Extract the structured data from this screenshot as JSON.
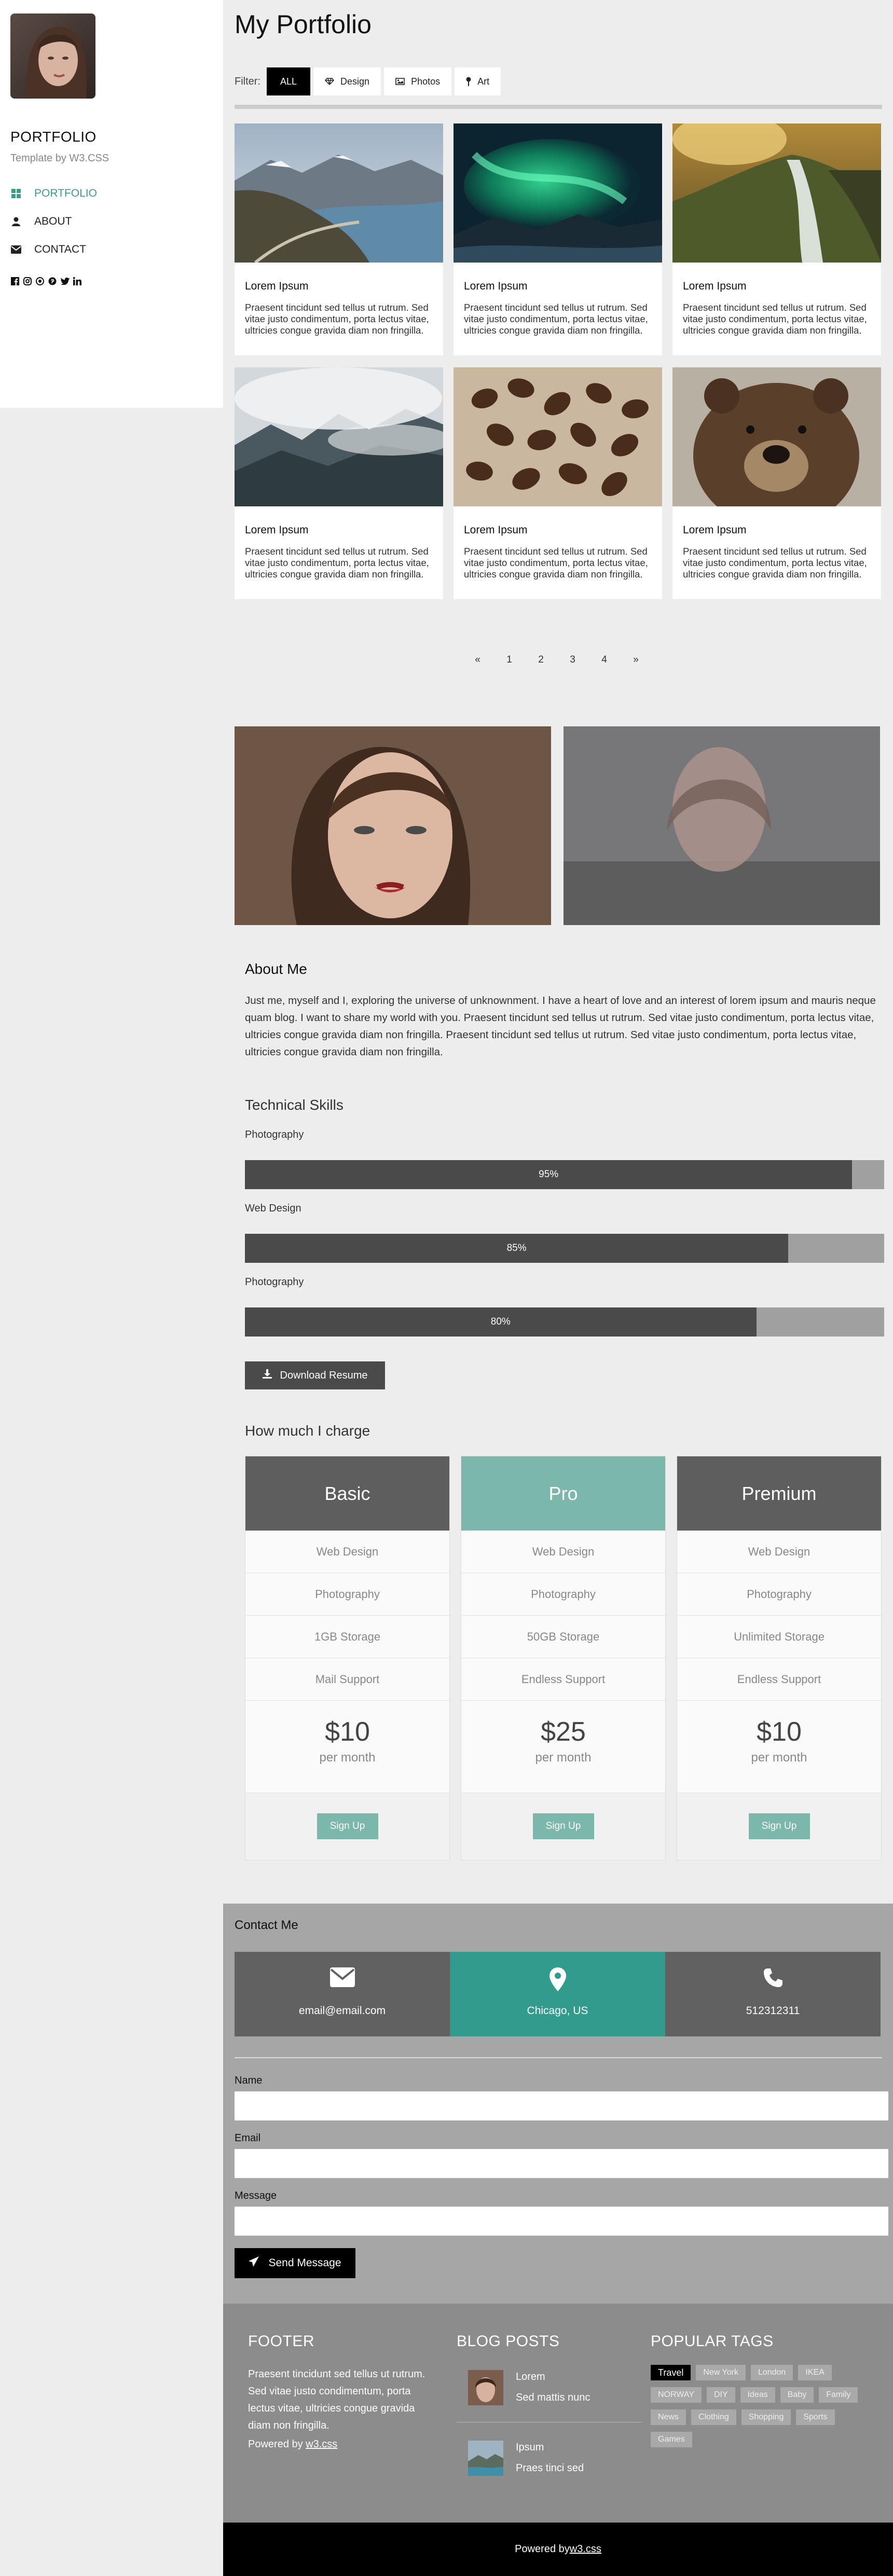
{
  "sidebar": {
    "brand": "PORTFOLIO",
    "tagline": "Template by W3.CSS",
    "nav": [
      {
        "label": "PORTFOLIO",
        "icon": "grid-icon"
      },
      {
        "label": "ABOUT",
        "icon": "user-icon"
      },
      {
        "label": "CONTACT",
        "icon": "envelope-icon"
      }
    ],
    "socials": [
      "facebook-icon",
      "instagram-icon",
      "snapchat-icon",
      "pinterest-icon",
      "twitter-icon",
      "linkedin-icon"
    ]
  },
  "header": {
    "title": "My Portfolio",
    "filter_label": "Filter:",
    "filters": [
      {
        "label": "ALL",
        "icon": ""
      },
      {
        "label": "Design",
        "icon": "diamond-icon"
      },
      {
        "label": "Photos",
        "icon": "photo-icon"
      },
      {
        "label": "Art",
        "icon": "map-pin-icon"
      }
    ]
  },
  "cards": [
    {
      "title": "Lorem Ipsum",
      "text": "Praesent tincidunt sed tellus ut rutrum. Sed vitae justo condimentum, porta lectus vitae, ultricies congue gravida diam non fringilla.",
      "image": "mountain-lake-photo"
    },
    {
      "title": "Lorem Ipsum",
      "text": "Praesent tincidunt sed tellus ut rutrum. Sed vitae justo condimentum, porta lectus vitae, ultricies congue gravida diam non fringilla.",
      "image": "northern-lights-photo"
    },
    {
      "title": "Lorem Ipsum",
      "text": "Praesent tincidunt sed tellus ut rutrum. Sed vitae justo condimentum, porta lectus vitae, ultricies congue gravida diam non fringilla.",
      "image": "waterfall-cliff-photo"
    },
    {
      "title": "Lorem Ipsum",
      "text": "Praesent tincidunt sed tellus ut rutrum. Sed vitae justo condimentum, porta lectus vitae, ultricies congue gravida diam non fringilla.",
      "image": "misty-forest-photo"
    },
    {
      "title": "Lorem Ipsum",
      "text": "Praesent tincidunt sed tellus ut rutrum. Sed vitae justo condimentum, porta lectus vitae, ultricies congue gravida diam non fringilla.",
      "image": "coffee-beans-photo"
    },
    {
      "title": "Lorem Ipsum",
      "text": "Praesent tincidunt sed tellus ut rutrum. Sed vitae justo condimentum, porta lectus vitae, ultricies congue gravida diam non fringilla.",
      "image": "bear-photo"
    }
  ],
  "pagination": [
    "«",
    "1",
    "2",
    "3",
    "4",
    "»"
  ],
  "about": {
    "title": "About Me",
    "text": "Just me, myself and I, exploring the universe of unknownment. I have a heart of love and an interest of lorem ipsum and mauris neque quam blog. I want to share my world with you. Praesent tincidunt sed tellus ut rutrum. Sed vitae justo condimentum, porta lectus vitae, ultricies congue gravida diam non fringilla. Praesent tincidunt sed tellus ut rutrum. Sed vitae justo condimentum, porta lectus vitae, ultricies congue gravida diam non fringilla."
  },
  "skills": {
    "title": "Technical Skills",
    "items": [
      {
        "label": "Photography",
        "value_text": "95%",
        "percent": 95
      },
      {
        "label": "Web Design",
        "value_text": "85%",
        "percent": 85
      },
      {
        "label": "Photography",
        "value_text": "80%",
        "percent": 80
      }
    ],
    "download_label": "Download Resume"
  },
  "pricing": {
    "title": "How much I charge",
    "plans": [
      {
        "name": "Basic",
        "features": [
          "Web Design",
          "Photography",
          "1GB Storage",
          "Mail Support"
        ],
        "price": "$10",
        "per": "per month",
        "cta": "Sign Up"
      },
      {
        "name": "Pro",
        "features": [
          "Web Design",
          "Photography",
          "50GB Storage",
          "Endless Support"
        ],
        "price": "$25",
        "per": "per month",
        "cta": "Sign Up"
      },
      {
        "name": "Premium",
        "features": [
          "Web Design",
          "Photography",
          "Unlimited Storage",
          "Endless Support"
        ],
        "price": "$10",
        "per": "per month",
        "cta": "Sign Up"
      }
    ]
  },
  "contact": {
    "title": "Contact Me",
    "boxes": [
      {
        "value": "email@email.com",
        "icon": "envelope-icon"
      },
      {
        "value": "Chicago, US",
        "icon": "map-marker-icon"
      },
      {
        "value": "512312311",
        "icon": "phone-icon"
      }
    ],
    "fields": [
      {
        "label": "Name",
        "value": ""
      },
      {
        "label": "Email",
        "value": ""
      },
      {
        "label": "Message",
        "value": ""
      }
    ],
    "send_label": "Send Message"
  },
  "footer": {
    "col1_title": "FOOTER",
    "col1_text": "Praesent tincidunt sed tellus ut rutrum. Sed vitae justo condimentum, porta lectus vitae, ultricies congue gravida diam non fringilla.",
    "powered_prefix": "Powered by ",
    "powered_link": "w3.css",
    "col2_title": "BLOG POSTS",
    "posts": [
      {
        "title": "Lorem",
        "subtitle": "Sed mattis nunc"
      },
      {
        "title": "Ipsum",
        "subtitle": "Praes tinci sed"
      }
    ],
    "col3_title": "POPULAR TAGS",
    "tags": [
      "Travel",
      "New York",
      "London",
      "IKEA",
      "NORWAY",
      "DIY",
      "Ideas",
      "Baby",
      "Family",
      "News",
      "Clothing",
      "Shopping",
      "Sports",
      "Games"
    ],
    "bottom_prefix": "Powered by ",
    "bottom_link": "w3.css"
  },
  "colors": {
    "accent": "#7bb7ab",
    "teal": "#339a8e",
    "dark": "#4a4a4a"
  }
}
